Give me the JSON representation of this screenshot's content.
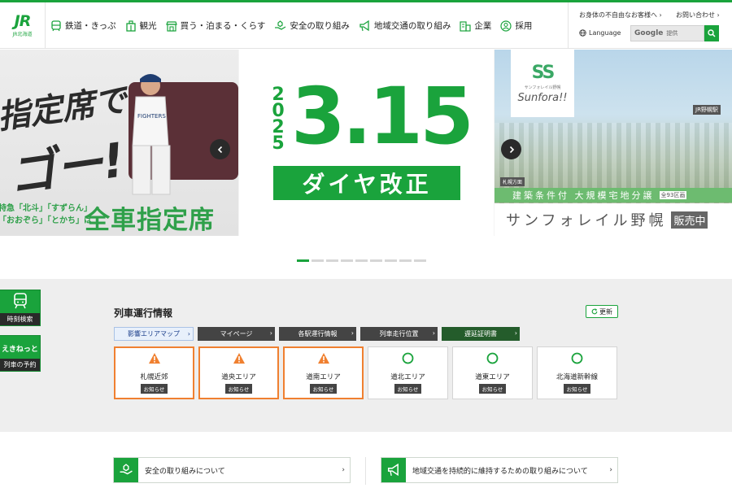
{
  "header": {
    "logo_mark": "JR",
    "logo_sub": "JR北海道",
    "nav": [
      {
        "label": "鉄道・きっぷ",
        "icon": "train-icon"
      },
      {
        "label": "観光",
        "icon": "building-icon"
      },
      {
        "label": "買う・泊まる・くらす",
        "icon": "shop-icon"
      },
      {
        "label": "安全の取り組み",
        "icon": "safety-hand-icon"
      },
      {
        "label": "地域交通の取り組み",
        "icon": "megaphone-icon"
      },
      {
        "label": "企業",
        "icon": "office-icon"
      },
      {
        "label": "採用",
        "icon": "person-icon"
      }
    ],
    "accessibility_link": "お身体の不自由なお客様へ",
    "contact_link": "お問い合わせ",
    "language_link": "Language",
    "search_brand": "Google",
    "search_placeholder": "提供"
  },
  "hero": {
    "left": {
      "line1": "指定席で",
      "line2": "ゴー!",
      "small1": "特急「北斗」「すずらん」",
      "small2": "「おおぞら」「とかち」は",
      "green": "全車指定席"
    },
    "center": {
      "year": "2025",
      "date": "3.15",
      "band": "ダイヤ改正"
    },
    "right": {
      "logo_mark": "SS",
      "logo_small": "サンフォレイル野幌",
      "logo_name": "Sunfora!!",
      "station_tag": "JR野幌駅",
      "area_tag": "札幌方面",
      "strip_text": "建築条件付 大規模宅地分譲",
      "strip_badge": "全93区画",
      "bottom_text": "サンフォレイル野幌",
      "bottom_badge": "販売中"
    },
    "dot_count": 9,
    "active_dot": 0
  },
  "side": {
    "timetable_label": "時刻検索",
    "ekinet_logo": "えきねっと",
    "reserve_label": "列車の予約"
  },
  "train_info": {
    "title": "列車運行情報",
    "refresh_label": "更新",
    "tabs": [
      {
        "label": "影響エリアマップ",
        "style": "map"
      },
      {
        "label": "マイページ",
        "style": "dark"
      },
      {
        "label": "各駅運行情報",
        "style": "dark"
      },
      {
        "label": "列車走行位置",
        "style": "dark"
      },
      {
        "label": "遅延証明書",
        "style": "green"
      }
    ],
    "areas": [
      {
        "name": "札幌近郊",
        "status": "warning",
        "button": "お知らせ"
      },
      {
        "name": "道央エリア",
        "status": "warning",
        "button": "お知らせ"
      },
      {
        "name": "道南エリア",
        "status": "warning",
        "button": "お知らせ"
      },
      {
        "name": "道北エリア",
        "status": "normal",
        "button": "お知らせ"
      },
      {
        "name": "道東エリア",
        "status": "normal",
        "button": "お知らせ"
      },
      {
        "name": "北海道新幹線",
        "status": "normal",
        "button": "お知らせ"
      }
    ]
  },
  "banners": [
    {
      "label": "安全の取り組みについて",
      "icon": "safety-hand-icon"
    },
    {
      "label": "地域交通を持続的に維持するための取り組みについて",
      "icon": "megaphone-icon"
    }
  ],
  "colors": {
    "brand_green": "#1aa33c",
    "warning_orange": "#f08030",
    "dark_tab": "#444444"
  }
}
